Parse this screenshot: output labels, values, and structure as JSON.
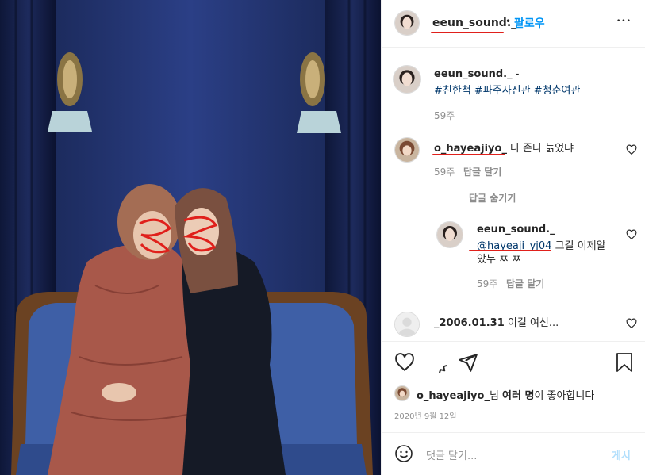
{
  "post": {
    "username": "eeun_sound._",
    "follow_label": "팔로우",
    "dot": "•",
    "more": "•••"
  },
  "caption": {
    "username": "eeun_sound._",
    "dash": "-",
    "hashtags": "#친한척 #파주사진관 #청춘여관",
    "time": "59주"
  },
  "comments": [
    {
      "username": "o_hayeajiyo_",
      "text": "나 존나 늙었냐",
      "time": "59주",
      "reply_label": "답글 달기"
    },
    {
      "username": "_2006.01.31",
      "text": "이걸 여신..."
    }
  ],
  "hide_replies_label": "답글 숨기기",
  "reply": {
    "username": "eeun_sound._",
    "mention": "@hayeaji_yj04",
    "text_line1": "그걸 이제알",
    "text_line2": "았누 ㅉ ㅉ",
    "time": "59주",
    "reply_label": "답글 달기"
  },
  "likes": {
    "username": "o_hayeajiyo_",
    "text_mid": "님 ",
    "others": "여러 명",
    "text_end": "이 좋아합니다"
  },
  "date": "2020년 9월 12일",
  "comment_box": {
    "placeholder": "댓글 달기...",
    "post_label": "게시"
  },
  "colors": {
    "link_blue": "#0095f6",
    "hashtag": "#00376b",
    "muted": "#8e8e8e",
    "ink": "#262626"
  },
  "icons": [
    "heart-icon",
    "comment-icon",
    "share-icon",
    "bookmark-icon",
    "emoji-icon",
    "more-icon"
  ]
}
